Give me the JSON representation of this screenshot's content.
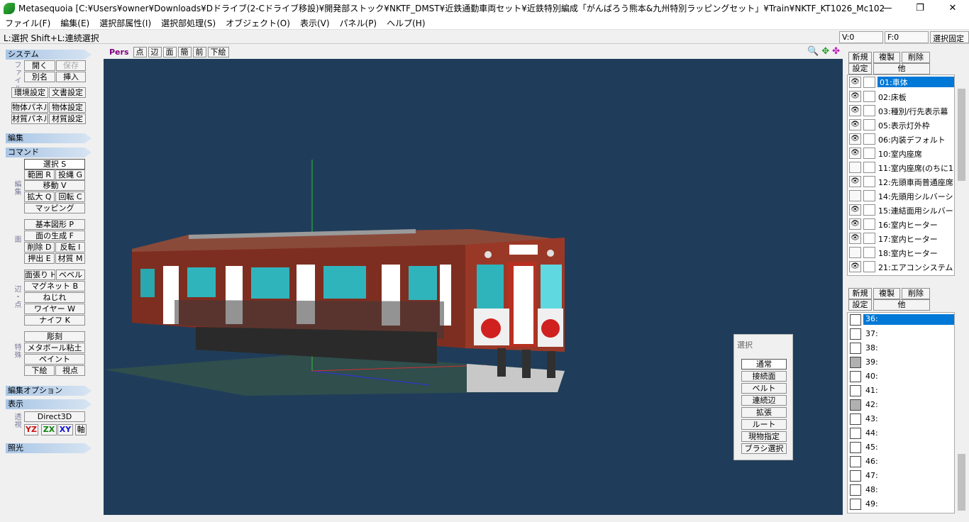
{
  "window": {
    "title": "Metasequoia [C:¥Users¥owner¥Downloads¥Dドライブ(2-Cドライブ移設)¥開発部ストック¥NKTF_DMST¥近鉄通勤車両セット¥近鉄特別編成「がんばろう熊本&九州特別ラッピングセット」¥Train¥NKTF_KT1026_Mc1029_Chear-Up_Kumamoto&Q¥b...",
    "minimize": "—",
    "maximize": "❐",
    "close": "✕"
  },
  "menu": [
    "ファイル(F)",
    "編集(E)",
    "選択部属性(I)",
    "選択部処理(S)",
    "オブジェクト(O)",
    "表示(V)",
    "パネル(P)",
    "ヘルプ(H)"
  ],
  "status": {
    "hint": "L:選択  Shift+L:連続選択",
    "v": "V:0",
    "f": "F:0",
    "lock": "選択固定"
  },
  "left": {
    "system": "システム",
    "file_label": "ファイル",
    "open": "開く",
    "save": "保存",
    "rename": "別名",
    "insert": "挿入",
    "env": "環境設定",
    "doc": "文書設定",
    "objpanel": "物体パネル",
    "objset": "物体設定",
    "matpanel": "材質パネル",
    "matset": "材質設定",
    "edit": "編集",
    "command": "コマンド",
    "edit_sub": "編集",
    "select": "選択 S",
    "range": "範囲 R",
    "lasso": "投縄 G",
    "move": "移動 V",
    "scale": "拡大 Q",
    "rotate": "回転 C",
    "mapping": "マッピング",
    "face_sub": "面",
    "prim": "基本図形 P",
    "genface": "面の生成 F",
    "del": "削除 D",
    "flip": "反転 I",
    "extrude": "押出 E",
    "mat": "材質 M",
    "edge_sub": "辺・点",
    "stretch": "面張り H",
    "bevel": "ベベル",
    "magnet": "マグネット B",
    "twist": "ねじれ",
    "wire": "ワイヤー W",
    "knife": "ナイフ K",
    "special_sub": "特殊",
    "sculpt": "彫刻",
    "metaball": "メタボール粘土",
    "paint": "ペイント",
    "underlay": "下絵",
    "viewpt": "視点",
    "editopt": "編集オプション",
    "display": "表示",
    "persp_sub": "透視",
    "d3d": "Direct3D",
    "yz": "YZ",
    "zx": "ZX",
    "xy": "XY",
    "axis": "軸",
    "light": "照光"
  },
  "viewtool": {
    "pers": "Pers",
    "point": "点",
    "edge": "辺",
    "face": "面",
    "simple": "簡",
    "front": "前",
    "underlay": "下絵",
    "zoom_icon": "🔍",
    "move_icon": "✥",
    "rot_icon": "✤"
  },
  "selpanel": {
    "title": "選択",
    "items": [
      "通常",
      "接続面",
      "ベルト",
      "連続辺",
      "拡張",
      "ルート",
      "現物指定",
      "ブラシ選択"
    ]
  },
  "objpanel": {
    "new": "新規",
    "dup": "複製",
    "del": "削除",
    "set": "設定",
    "other": "他",
    "items": [
      "01:車体",
      "02:床板",
      "03:種別/行先表示幕",
      "05:表示灯外枠",
      "06:内装デフォルト",
      "10:室内座席",
      "11:室内座席(のちに1",
      "12:先頭車両普通座席",
      "14:先頭用シルバーシ",
      "15:連結面用シルバー",
      "16:室内ヒーター",
      "17:室内ヒーター",
      "18:室内ヒーター",
      "21:エアコンシステム"
    ],
    "visible": [
      true,
      true,
      true,
      true,
      true,
      true,
      false,
      true,
      false,
      true,
      true,
      true,
      false,
      true
    ]
  },
  "matpanel": {
    "new": "新規",
    "dup": "複製",
    "del": "削除",
    "set": "設定",
    "other": "他",
    "items": [
      "36:",
      "37:",
      "38:",
      "39:",
      "40:",
      "41:",
      "42:",
      "43:",
      "44:",
      "45:",
      "46:",
      "47:",
      "48:",
      "49:"
    ],
    "gray": [
      false,
      false,
      false,
      true,
      false,
      false,
      true,
      false,
      false,
      false,
      false,
      false,
      false,
      false
    ]
  }
}
